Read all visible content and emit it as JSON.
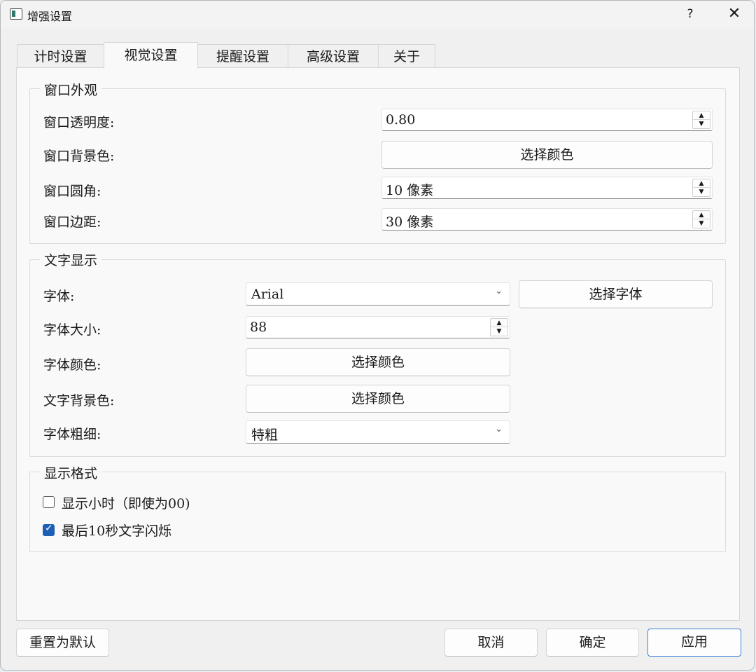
{
  "window": {
    "title": "增强设置",
    "help": "?",
    "close": "✕"
  },
  "tabs": [
    {
      "label": "计时设置"
    },
    {
      "label": "视觉设置",
      "active": true
    },
    {
      "label": "提醒设置"
    },
    {
      "label": "高级设置"
    },
    {
      "label": "关于"
    }
  ],
  "appearance": {
    "title": "窗口外观",
    "opacity_label": "窗口透明度:",
    "opacity_value": "0.80",
    "bg_color_label": "窗口背景色:",
    "bg_color_button": "选择颜色",
    "radius_label": "窗口圆角:",
    "radius_value": "10 像素",
    "margin_label": "窗口边距:",
    "margin_value": "30 像素"
  },
  "text": {
    "title": "文字显示",
    "font_label": "字体:",
    "font_value": "Arial",
    "font_button": "选择字体",
    "size_label": "字体大小:",
    "size_value": "88",
    "color_label": "字体颜色:",
    "color_button": "选择颜色",
    "bg_label": "文字背景色:",
    "bg_button": "选择颜色",
    "weight_label": "字体粗细:",
    "weight_value": "特粗"
  },
  "format": {
    "title": "显示格式",
    "show_hours_label": "显示小时（即使为00)",
    "show_hours_checked": false,
    "blink_label": "最后10秒文字闪烁",
    "blink_checked": true
  },
  "footer": {
    "reset": "重置为默认",
    "cancel": "取消",
    "ok": "确定",
    "apply": "应用"
  },
  "colors": {
    "accent": "#1d5fb4",
    "focus_border": "#3d7fd6"
  }
}
